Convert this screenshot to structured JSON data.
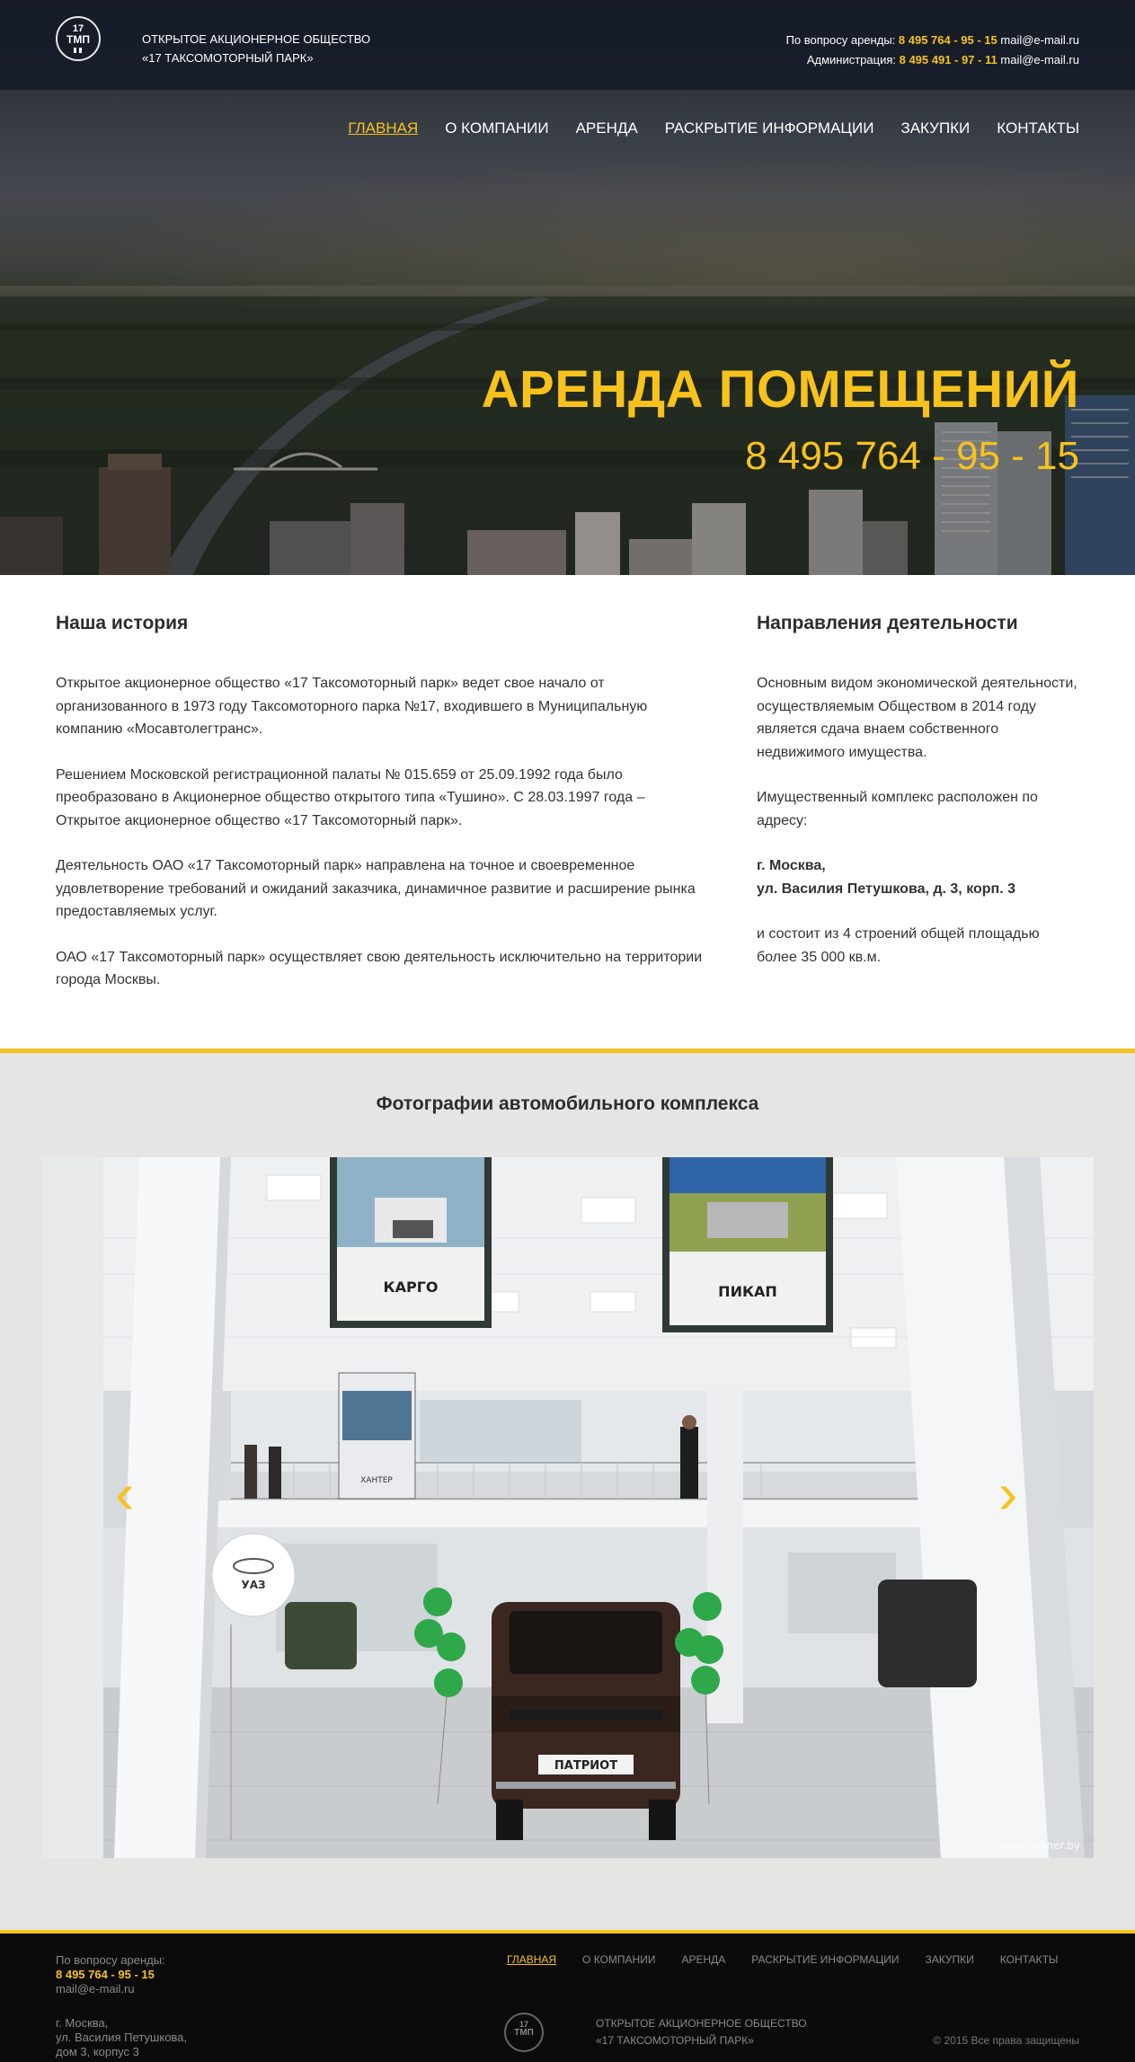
{
  "header": {
    "logo_number": "17",
    "logo_text": "ТМП",
    "company_line1": "ОТКРЫТОЕ АКЦИОНЕРНОЕ ОБЩЕСТВО",
    "company_line2": "«17 ТАКСОМОТОРНЫЙ ПАРК»",
    "rent_label": "По вопросу аренды:",
    "rent_phone": "8 495 764 - 95 - 15",
    "rent_email": "mail@e-mail.ru",
    "admin_label": "Администрация:",
    "admin_phone": "8 495 491 - 97 - 11",
    "admin_email": "mail@e-mail.ru"
  },
  "nav": {
    "items": [
      {
        "label": "ГЛАВНАЯ",
        "active": true
      },
      {
        "label": "О КОМПАНИИ"
      },
      {
        "label": "АРЕНДА"
      },
      {
        "label": "РАСКРЫТИЕ ИНФОРМАЦИИ"
      },
      {
        "label": "ЗАКУПКИ"
      },
      {
        "label": "КОНТАКТЫ"
      }
    ]
  },
  "hero": {
    "title": "АРЕНДА ПОМЕЩЕНИЙ",
    "phone": "8 495 764 - 95 - 15"
  },
  "history": {
    "title": "Наша история",
    "paragraphs": [
      "Открытое акционерное общество «17 Таксомоторный парк» ведет свое начало от организованного в 1973 году Таксомоторного парка №17, входившего в Муниципальную компанию «Мосавтолегтранс».",
      "Решением Московской регистрационной палаты № 015.659 от 25.09.1992 года было преобразовано в Акционерное общество открытого типа «Тушино». С 28.03.1997 года – Открытое акционерное общество «17 Таксомоторный парк».",
      "Деятельность ОАО «17 Таксомоторный парк» направлена на точное и своевременное удовлетворение требований и ожиданий заказчика, динамичное развитие и расширение рынка предоставляемых услуг.",
      "ОАО «17 Таксомоторный парк» осуществляет свою деятельность исключительно на территории города Москвы."
    ]
  },
  "activities": {
    "title": "Направления деятельности",
    "p1": "Основным видом экономической деятельности, осуществляемым Обществом в 2014 году является сдача внаем собственного недвижимого имущества.",
    "p2": "Имущественный комплекс расположен по адресу:",
    "address_line1": "г. Москва,",
    "address_line2": "ул. Василия Петушкова, д. 3, корп. 3",
    "p3": "и состоит из 4 строений общей площадью более 35 000 кв.м."
  },
  "gallery": {
    "title": "Фотографии автомобильного комплекса",
    "prev_arrow": "‹",
    "next_arrow": "›",
    "banner_left": "КАРГО",
    "banner_right": "ПИКАП",
    "banner_small": "ХАНТЕР",
    "balloon_text": "УАЗ",
    "plate_text": "ПАТРИОТ",
    "watermark": "auto.onliner.by"
  },
  "footer": {
    "rent_label": "По вопросу аренды:",
    "rent_phone": "8 495 764 - 95 - 15",
    "email": "mail@e-mail.ru",
    "address_line1": "г. Москва,",
    "address_line2": "ул. Василия Петушкова,",
    "address_line3": "дом 3, корпус 3",
    "nav": [
      {
        "label": "ГЛАВНАЯ",
        "active": true
      },
      {
        "label": "О КОМПАНИИ"
      },
      {
        "label": "АРЕНДА"
      },
      {
        "label": "РАСКРЫТИЕ ИНФОРМАЦИИ"
      },
      {
        "label": "ЗАКУПКИ"
      },
      {
        "label": "КОНТАКТЫ"
      }
    ],
    "logo_number": "17",
    "logo_text": "ТМП",
    "company_line1": "ОТКРЫТОЕ АКЦИОНЕРНОЕ ОБЩЕСТВО",
    "company_line2": "«17 ТАКСОМОТОРНЫЙ ПАРК»",
    "copyright": "© 2015 Все права защищены"
  },
  "colors": {
    "accent": "#f7c21c",
    "header_bg": "#141a26",
    "footer_bg": "#0b0b0b",
    "gallery_bg": "#e5e5e3"
  }
}
